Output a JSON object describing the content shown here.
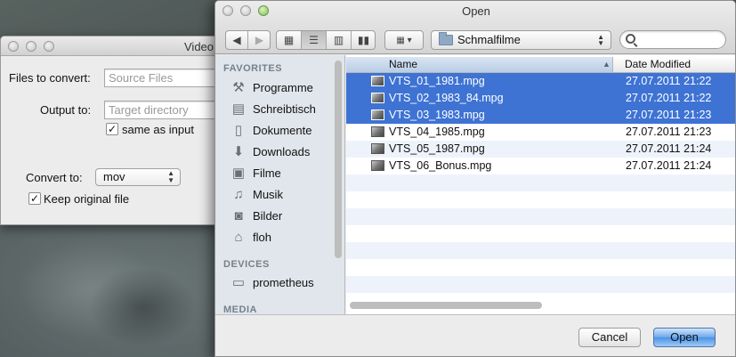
{
  "converter": {
    "title": "Video",
    "files_label": "Files to convert:",
    "files_placeholder": "Source Files",
    "output_label": "Output to:",
    "output_placeholder": "Target directory",
    "same_as_input_label": "same as input",
    "same_as_input_checked": true,
    "convert_to_label": "Convert to:",
    "convert_to_value": "mov",
    "keep_original_label": "Keep original file",
    "keep_original_checked": true
  },
  "dialog": {
    "title": "Open",
    "current_folder": "Schmalfilme",
    "sidebar": {
      "favorites_header": "FAVORITES",
      "favorites": [
        {
          "label": "Programme",
          "icon": "applications-icon"
        },
        {
          "label": "Schreibtisch",
          "icon": "desktop-icon"
        },
        {
          "label": "Dokumente",
          "icon": "documents-icon"
        },
        {
          "label": "Downloads",
          "icon": "downloads-icon"
        },
        {
          "label": "Filme",
          "icon": "movies-icon"
        },
        {
          "label": "Musik",
          "icon": "music-icon"
        },
        {
          "label": "Bilder",
          "icon": "pictures-icon"
        },
        {
          "label": "floh",
          "icon": "home-icon"
        }
      ],
      "devices_header": "DEVICES",
      "devices": [
        {
          "label": "prometheus",
          "icon": "computer-icon"
        }
      ],
      "media_header": "MEDIA"
    },
    "columns": {
      "name": "Name",
      "date": "Date Modified"
    },
    "files": [
      {
        "name": "VTS_01_1981.mpg",
        "date": "27.07.2011 21:22",
        "selected": true
      },
      {
        "name": "VTS_02_1983_84.mpg",
        "date": "27.07.2011 21:22",
        "selected": true
      },
      {
        "name": "VTS_03_1983.mpg",
        "date": "27.07.2011 21:23",
        "selected": true
      },
      {
        "name": "VTS_04_1985.mpg",
        "date": "27.07.2011 21:23",
        "selected": false
      },
      {
        "name": "VTS_05_1987.mpg",
        "date": "27.07.2011 21:24",
        "selected": false
      },
      {
        "name": "VTS_06_Bonus.mpg",
        "date": "27.07.2011 21:24",
        "selected": false
      }
    ],
    "cancel_label": "Cancel",
    "open_label": "Open"
  },
  "colors": {
    "selection": "#3e73d4",
    "sidebar_bg": "#e1e6ec",
    "default_button": "#6ba7ec"
  }
}
